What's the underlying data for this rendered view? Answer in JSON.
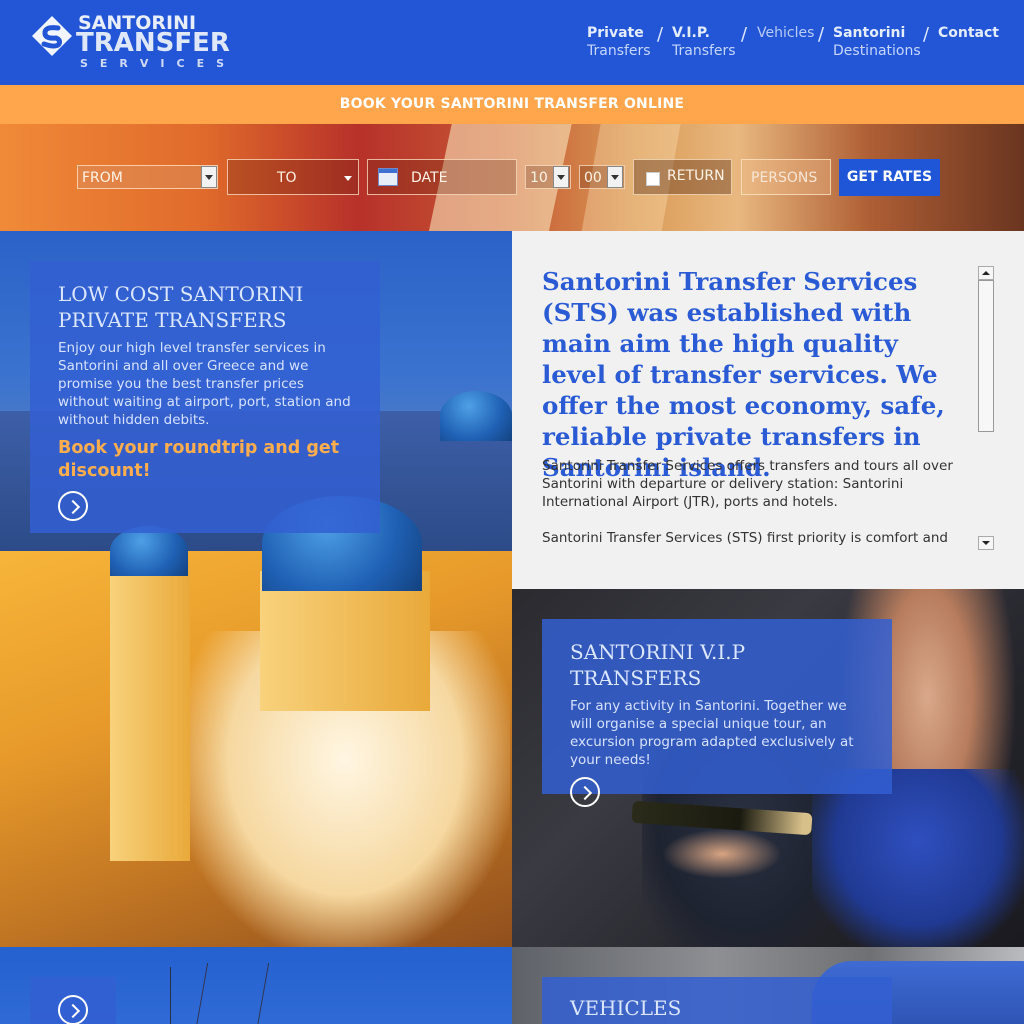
{
  "header": {
    "logo": {
      "line1": "SANTORINI",
      "line2": "TRANSFER",
      "line3": "SERVICES"
    },
    "nav": [
      {
        "line1": "Private",
        "line2": "Transfers"
      },
      {
        "line1": "V.I.P.",
        "line2": "Transfers"
      },
      {
        "line1": "Vehicles",
        "line2": ""
      },
      {
        "line1": "Santorini",
        "line2": "Destinations"
      },
      {
        "line1": "Contact",
        "line2": ""
      }
    ],
    "separator": "/"
  },
  "book_bar": {
    "text": "BOOK YOUR SANTORINI TRANSFER ONLINE"
  },
  "booking": {
    "from": "FROM",
    "to": "TO",
    "date": "DATE",
    "hour": "10",
    "minute": "00",
    "return_label": "RETURN",
    "persons": "PERSONS",
    "submit": "GET RATES"
  },
  "low_cost": {
    "title": "LOW COST SANTORINI PRIVATE TRANSFERS",
    "text": "Enjoy our high level transfer services in Santorini and all over Greece and we promise you the best transfer prices without waiting at airport, port, station and without hidden debits.",
    "cta": "Book your roundtrip and get discount!"
  },
  "intro": {
    "heading": "Santorini Transfer Services (STS) was established with main aim the high quality level of transfer services. We offer the most economy, safe, reliable private transfers in Santorini island.",
    "para1": "Santorini Transfer Services offers transfers and tours all over Santorini with departure or delivery station: Santorini International Airport (JTR), ports and hotels.",
    "para2": "Santorini Transfer Services (STS) first priority is comfort and safe. Our  ..."
  },
  "vip": {
    "title": "SANTORINI V.I.P TRANSFERS",
    "text": "For any activity in Santorini. Together we will organise a special unique tour, an excursion program adapted exclusively at your needs!"
  },
  "vehicles": {
    "title": "VEHICLES"
  },
  "colors": {
    "brand_blue": "#2356d6",
    "orange": "#ffa54c",
    "cta_orange": "#ffad4d",
    "button_blue": "#1f56d8"
  }
}
